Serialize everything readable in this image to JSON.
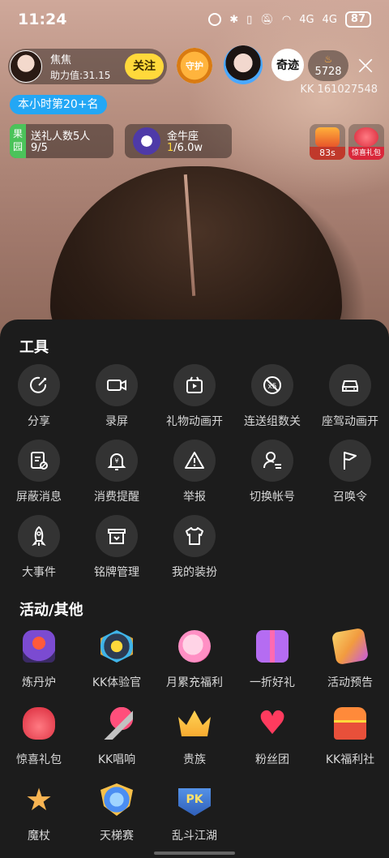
{
  "status_bar": {
    "time": "11:24",
    "signal_labels": [
      "4G",
      "4G"
    ],
    "battery": "87"
  },
  "host": {
    "name": "焦焦",
    "support_value": "助力值:31.15",
    "follow_label": "关注",
    "guard_badge": "守护"
  },
  "top_right": {
    "fan_badge_text": "奇迹",
    "hot_value": "5728",
    "room_id": "KK 161027548"
  },
  "rank": {
    "label": "本小时第20+名"
  },
  "tasks": {
    "tag": "果园",
    "title": "送礼人数5人",
    "progress": "9/5"
  },
  "zodiac": {
    "title": "金牛座",
    "progress_current": "1",
    "progress_total": "/6.0w"
  },
  "mini_boxes": [
    {
      "caption": "83s",
      "color": "#ff7a1a"
    },
    {
      "caption": "惊喜礼包",
      "color": "#ff4d5a"
    }
  ],
  "tools": {
    "title": "工具",
    "items": [
      {
        "label": "分享",
        "icon": "share-icon"
      },
      {
        "label": "录屏",
        "icon": "video-camera-icon"
      },
      {
        "label": "礼物动画开",
        "icon": "gift-animation-icon"
      },
      {
        "label": "连送组数关",
        "icon": "combo-off-icon"
      },
      {
        "label": "座驾动画开",
        "icon": "car-icon"
      },
      {
        "label": "屏蔽消息",
        "icon": "block-message-icon"
      },
      {
        "label": "消费提醒",
        "icon": "bell-yuan-icon"
      },
      {
        "label": "举报",
        "icon": "warning-icon"
      },
      {
        "label": "切换帐号",
        "icon": "switch-account-icon"
      },
      {
        "label": "召唤令",
        "icon": "flag-icon"
      },
      {
        "label": "大事件",
        "icon": "rocket-icon"
      },
      {
        "label": "铭牌管理",
        "icon": "nameplate-icon"
      },
      {
        "label": "我的装扮",
        "icon": "tshirt-icon"
      }
    ]
  },
  "activities": {
    "title": "活动/其他",
    "items": [
      {
        "label": "炼丹炉",
        "icon": "alchemy-furnace-icon",
        "color": "#7b4bd1"
      },
      {
        "label": "KK体验官",
        "icon": "kk-experience-icon",
        "color": "#3fb4e8"
      },
      {
        "label": "月累充福利",
        "icon": "monthly-recharge-icon",
        "color": "#ff8fc4"
      },
      {
        "label": "一折好礼",
        "icon": "discount-gift-icon",
        "color": "#b56cf2"
      },
      {
        "label": "活动预告",
        "icon": "event-preview-icon",
        "color": "#f29b3f"
      },
      {
        "label": "惊喜礼包",
        "icon": "surprise-bag-icon",
        "color": "#ff4d5a"
      },
      {
        "label": "KK唱响",
        "icon": "microphone-icon",
        "color": "#ff4f7b"
      },
      {
        "label": "贵族",
        "icon": "crown-icon",
        "color": "#f7b52c"
      },
      {
        "label": "粉丝团",
        "icon": "heart-icon",
        "color": "#ff3b5e"
      },
      {
        "label": "KK福利社",
        "icon": "treasure-chest-icon",
        "color": "#e8503a"
      },
      {
        "label": "魔杖",
        "icon": "magic-wand-icon",
        "color": "#f29b3f"
      },
      {
        "label": "天梯赛",
        "icon": "ladder-match-icon",
        "color": "#4b8ef2"
      },
      {
        "label": "乱斗江湖",
        "icon": "pk-battle-icon",
        "color": "#3a78d8"
      }
    ]
  }
}
